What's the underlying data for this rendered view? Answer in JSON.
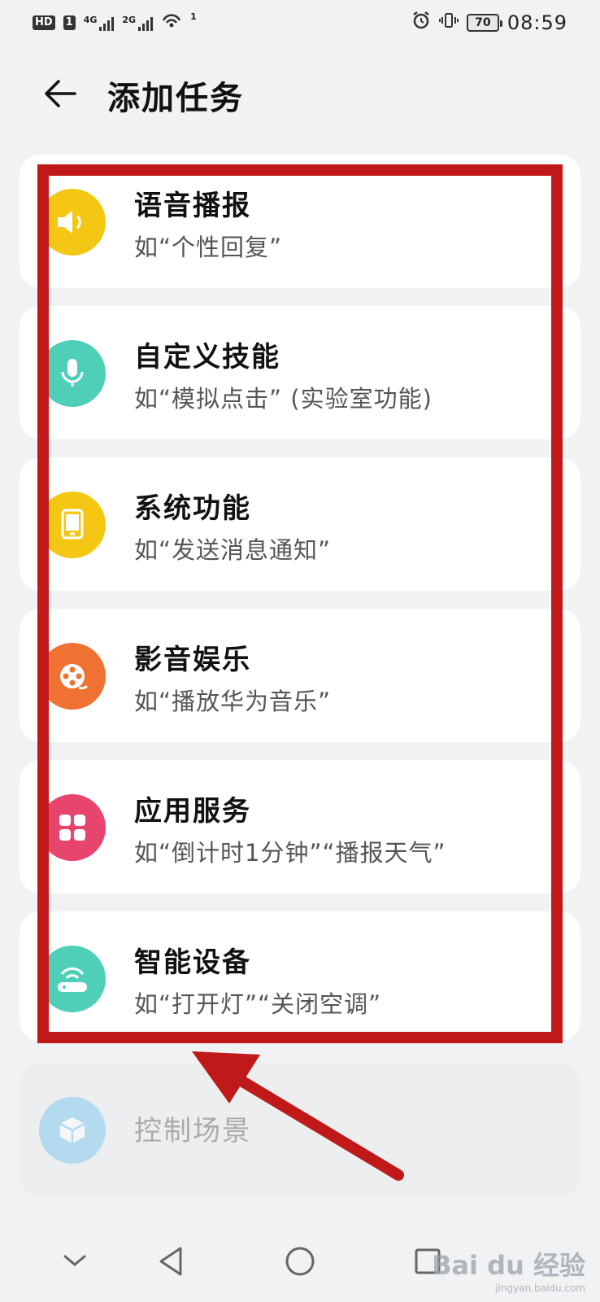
{
  "status_bar": {
    "left_badge": "HD",
    "left_badge2": "1",
    "net1": "4G",
    "net2": "2G",
    "wifi_sup": "1",
    "battery": "70",
    "time": "08:59"
  },
  "header": {
    "title": "添加任务"
  },
  "tasks": [
    {
      "title": "语音播报",
      "subtitle": "如“个性回复”",
      "icon": "speaker-icon",
      "color": "#f3c714"
    },
    {
      "title": "自定义技能",
      "subtitle": "如“模拟点击” (实验室功能)",
      "icon": "microphone-icon",
      "color": "#4fcfb8"
    },
    {
      "title": "系统功能",
      "subtitle": "如“发送消息通知”",
      "icon": "tablet-icon",
      "color": "#f3c714"
    },
    {
      "title": "影音娱乐",
      "subtitle": "如“播放华为音乐”",
      "icon": "film-reel-icon",
      "color": "#f07232"
    },
    {
      "title": "应用服务",
      "subtitle": "如“倒计时1分钟”“播报天气”",
      "icon": "apps-grid-icon",
      "color": "#e8456e"
    },
    {
      "title": "智能设备",
      "subtitle": "如“打开灯”“关闭空调”",
      "icon": "smart-device-icon",
      "color": "#4fcfb8"
    }
  ],
  "disabled_task": {
    "title": "控制场景",
    "icon": "cube-icon",
    "color": "#7cc8ee"
  },
  "watermark": {
    "text": "Bai du 经验",
    "sub": "jingyan.baidu.com"
  }
}
